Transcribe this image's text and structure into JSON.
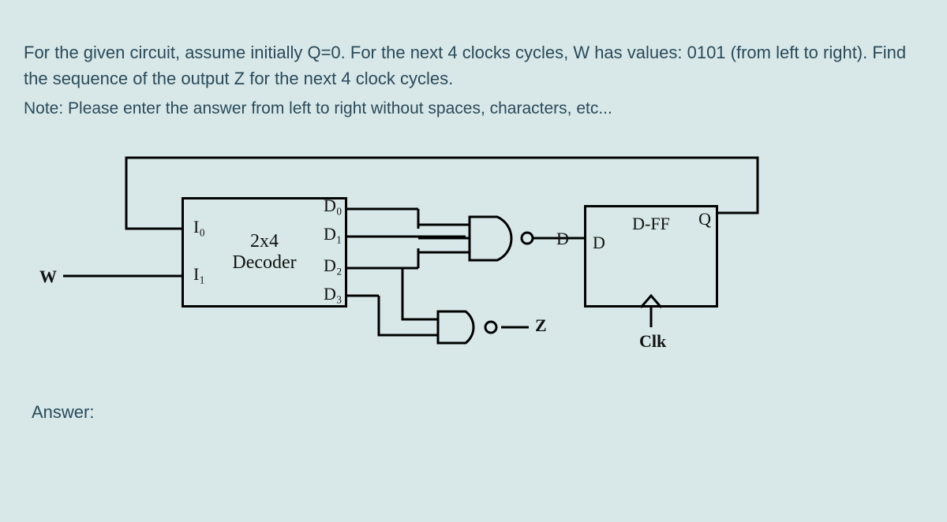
{
  "question": {
    "paragraph": "For the given circuit, assume initially Q=0. For the next 4 clocks cycles, W has values: 0101 (from left to right). Find the sequence of the output Z for the next 4 clock cycles.",
    "note": "Note: Please enter the answer from left to right without spaces, characters, etc..."
  },
  "circuit": {
    "inputs": {
      "w": "W"
    },
    "decoder": {
      "title_line1": "2x4",
      "title_line2": "Decoder",
      "in0": "I₀",
      "in1": "I₁",
      "out0": "D₀",
      "out1": "D₁",
      "out2": "D₂",
      "out3": "D₃"
    },
    "gates": {
      "d_gate_output": "D",
      "z_gate_output": "Z"
    },
    "flipflop": {
      "title": "D-FF",
      "d_pin": "D",
      "q_pin": "Q",
      "clk": "Clk"
    }
  },
  "answer_label": "Answer:",
  "chart_data": {
    "type": "diagram",
    "description": "Sequential logic circuit",
    "initial_state": {
      "Q": 0
    },
    "input_sequence": {
      "W": [
        0,
        1,
        0,
        1
      ]
    },
    "clock_cycles": 4,
    "components": [
      {
        "name": "2x4 Decoder",
        "inputs": [
          "I0 = Q",
          "I1 = W"
        ],
        "outputs": [
          "D0",
          "D1",
          "D2",
          "D3"
        ]
      },
      {
        "name": "AND gate (3-input) feeding D",
        "inputs": [
          "D0",
          "D1",
          "D2"
        ],
        "output": "D (to D-FF)"
      },
      {
        "name": "AND gate (2-input) output Z",
        "inputs": [
          "D2",
          "D3"
        ],
        "output": "Z"
      },
      {
        "name": "D Flip-Flop",
        "inputs": [
          "D",
          "Clk"
        ],
        "output": "Q (fed back to I0)"
      }
    ],
    "requested_output": "Sequence of Z over 4 clock cycles"
  }
}
